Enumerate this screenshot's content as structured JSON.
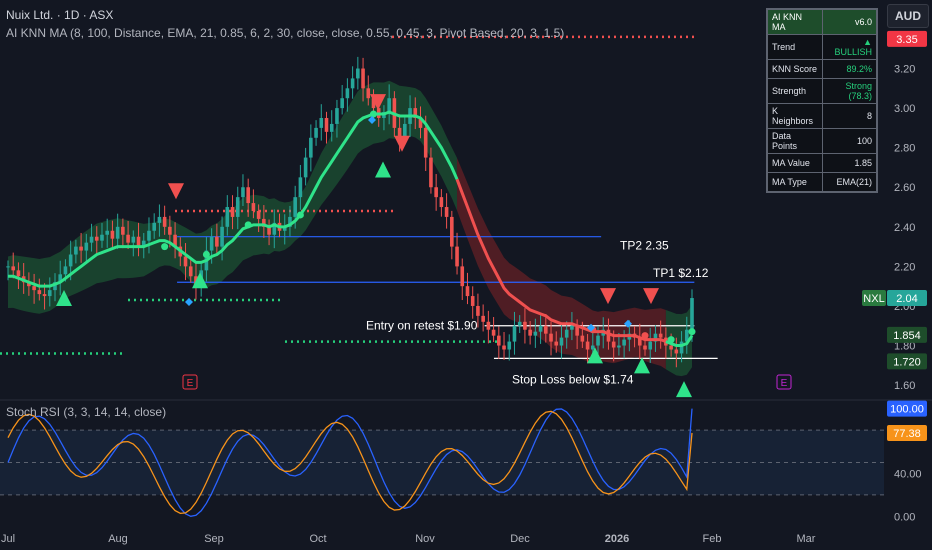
{
  "header": {
    "symbol_line": "Nuix Ltd. · 1D · ASX",
    "indicator_line": "AI KNN MA (8, 100, Distance, EMA, 21, 0.85, 6, 2, 30, close, close, 0.55, 0.45, 3, Pivot Based, 20, 3, 1.5)",
    "stoch_line": "Stoch RSI (3, 3, 14, 14, close)",
    "currency": "AUD"
  },
  "knn_table": {
    "title": "AI KNN MA",
    "version": "v6.0",
    "rows": [
      {
        "label": "Trend",
        "value": "▲ BULLISH",
        "color": "#26d07c"
      },
      {
        "label": "KNN Score",
        "value": "89.2%",
        "color": "#26d07c"
      },
      {
        "label": "Strength",
        "value": "Strong (78.3)",
        "color": "#26d07c"
      },
      {
        "label": "K Neighbors",
        "value": "8",
        "color": "#e0e3eb"
      },
      {
        "label": "Data Points",
        "value": "100",
        "color": "#e0e3eb"
      },
      {
        "label": "MA Value",
        "value": "1.85",
        "color": "#e0e3eb"
      },
      {
        "label": "MA Type",
        "value": "EMA(21)",
        "color": "#e0e3eb"
      }
    ]
  },
  "price_tags": [
    {
      "text": "3.35",
      "bg": "#f23645",
      "fg": "#ffffff",
      "price": 3.35
    },
    {
      "text": "NXL",
      "bg": "#2a7a3f",
      "fg": "#ffffff",
      "price": 2.04,
      "side": "left"
    },
    {
      "text": "2.04",
      "bg": "#26a69a",
      "fg": "#ffffff",
      "price": 2.04
    },
    {
      "text": "1.854",
      "bg": "#1e4d2b",
      "fg": "#ffffff",
      "price": 1.854
    },
    {
      "text": "1.720",
      "bg": "#1e4d2b",
      "fg": "#ffffff",
      "price": 1.72
    },
    {
      "text": "100.00",
      "bg": "#2962ff",
      "fg": "#ffffff",
      "stoch": 100
    },
    {
      "text": "77.38",
      "bg": "#f7931a",
      "fg": "#ffffff",
      "stoch": 77.38
    }
  ],
  "annotations": {
    "tp2": "TP2 2.35",
    "tp1": "TP1 $2.12",
    "entry": "Entry on retest $1.90",
    "stop": "Stop Loss below $1.74"
  },
  "colors": {
    "bg": "#131722",
    "up": "#26a69a",
    "down": "#ef5350",
    "ma_bull": "#2fe38a",
    "ma_bear": "#f0504f",
    "band_bull": "#1b4a30",
    "band_bear": "#5a1e25",
    "level_line": "#2962ff",
    "k": "#2962ff",
    "d": "#f7931a",
    "pivot_red": "#f0504f",
    "pivot_green": "#26d07c"
  },
  "chart_data": {
    "type": "candlestick",
    "x_ticks": [
      "Jul",
      "Aug",
      "Sep",
      "Oct",
      "Nov",
      "Dec",
      "2026",
      "Feb",
      "Mar"
    ],
    "y_ticks": [
      1.6,
      1.8,
      2.0,
      2.2,
      2.4,
      2.6,
      2.8,
      3.0,
      3.2
    ],
    "ylim": [
      1.55,
      3.42
    ],
    "close_series": [
      2.2,
      2.18,
      2.15,
      2.12,
      2.1,
      2.08,
      2.06,
      2.05,
      2.08,
      2.12,
      2.16,
      2.2,
      2.26,
      2.3,
      2.28,
      2.32,
      2.35,
      2.33,
      2.36,
      2.38,
      2.34,
      2.4,
      2.36,
      2.32,
      2.35,
      2.3,
      2.33,
      2.38,
      2.42,
      2.45,
      2.4,
      2.36,
      2.3,
      2.25,
      2.2,
      2.15,
      2.1,
      2.18,
      2.28,
      2.35,
      2.3,
      2.4,
      2.5,
      2.45,
      2.55,
      2.6,
      2.52,
      2.48,
      2.44,
      2.4,
      2.36,
      2.42,
      2.38,
      2.4,
      2.45,
      2.55,
      2.65,
      2.75,
      2.85,
      2.9,
      2.95,
      2.88,
      2.92,
      3.0,
      3.05,
      3.1,
      3.15,
      3.2,
      3.1,
      3.05,
      3.0,
      2.95,
      2.98,
      3.05,
      2.9,
      2.85,
      2.92,
      3.0,
      2.95,
      2.9,
      2.75,
      2.6,
      2.55,
      2.5,
      2.45,
      2.3,
      2.2,
      2.1,
      2.05,
      2.0,
      1.95,
      1.92,
      1.88,
      1.85,
      1.8,
      1.78,
      1.82,
      1.9,
      1.92,
      1.88,
      1.85,
      1.87,
      1.9,
      1.86,
      1.82,
      1.8,
      1.84,
      1.88,
      1.9,
      1.85,
      1.82,
      1.78,
      1.8,
      1.85,
      1.88,
      1.82,
      1.79,
      1.8,
      1.83,
      1.86,
      1.84,
      1.8,
      1.78,
      1.82,
      1.86,
      1.84,
      1.8,
      1.78,
      1.76,
      1.82,
      1.88,
      2.04
    ],
    "ma_series": [
      2.15,
      2.15,
      2.14,
      2.13,
      2.12,
      2.11,
      2.1,
      2.1,
      2.1,
      2.11,
      2.12,
      2.14,
      2.16,
      2.18,
      2.2,
      2.22,
      2.24,
      2.26,
      2.27,
      2.28,
      2.29,
      2.3,
      2.3,
      2.3,
      2.3,
      2.3,
      2.3,
      2.31,
      2.32,
      2.33,
      2.33,
      2.32,
      2.3,
      2.28,
      2.26,
      2.24,
      2.22,
      2.22,
      2.23,
      2.25,
      2.26,
      2.28,
      2.31,
      2.33,
      2.36,
      2.39,
      2.4,
      2.41,
      2.41,
      2.41,
      2.4,
      2.41,
      2.4,
      2.4,
      2.41,
      2.43,
      2.46,
      2.5,
      2.55,
      2.6,
      2.65,
      2.69,
      2.73,
      2.77,
      2.81,
      2.85,
      2.89,
      2.93,
      2.95,
      2.96,
      2.97,
      2.97,
      2.97,
      2.98,
      2.97,
      2.96,
      2.96,
      2.96,
      2.96,
      2.95,
      2.92,
      2.88,
      2.84,
      2.8,
      2.75,
      2.7,
      2.64,
      2.57,
      2.5,
      2.43,
      2.36,
      2.3,
      2.24,
      2.19,
      2.14,
      2.09,
      2.06,
      2.04,
      2.02,
      2.0,
      1.98,
      1.97,
      1.96,
      1.95,
      1.93,
      1.92,
      1.91,
      1.91,
      1.91,
      1.9,
      1.89,
      1.88,
      1.87,
      1.87,
      1.87,
      1.86,
      1.85,
      1.85,
      1.85,
      1.85,
      1.85,
      1.84,
      1.83,
      1.83,
      1.83,
      1.83,
      1.82,
      1.81,
      1.8,
      1.8,
      1.81,
      1.85
    ],
    "ma_trend": [
      "bull:0-85",
      "bear:86-126",
      "bull:127-131"
    ],
    "horizontal_levels": [
      {
        "label": "TP2 2.35",
        "price": 2.35,
        "x_range": [
          0.19,
          0.645
        ]
      },
      {
        "label": "TP1 $2.12",
        "price": 2.12,
        "x_range": [
          0.19,
          0.745
        ]
      },
      {
        "label": "Entry on retest $1.90",
        "price": 1.9,
        "x_range": [
          0.52,
          0.745
        ]
      },
      {
        "label": "Stop Loss below $1.74",
        "price": 1.735,
        "x_range": [
          0.53,
          0.77
        ]
      }
    ],
    "stoch_rsi": {
      "ylim": [
        -8,
        108
      ],
      "y_ticks": [
        0.0,
        40.0,
        80.0
      ],
      "k_last": 100.0,
      "d_last": 77.38
    }
  }
}
